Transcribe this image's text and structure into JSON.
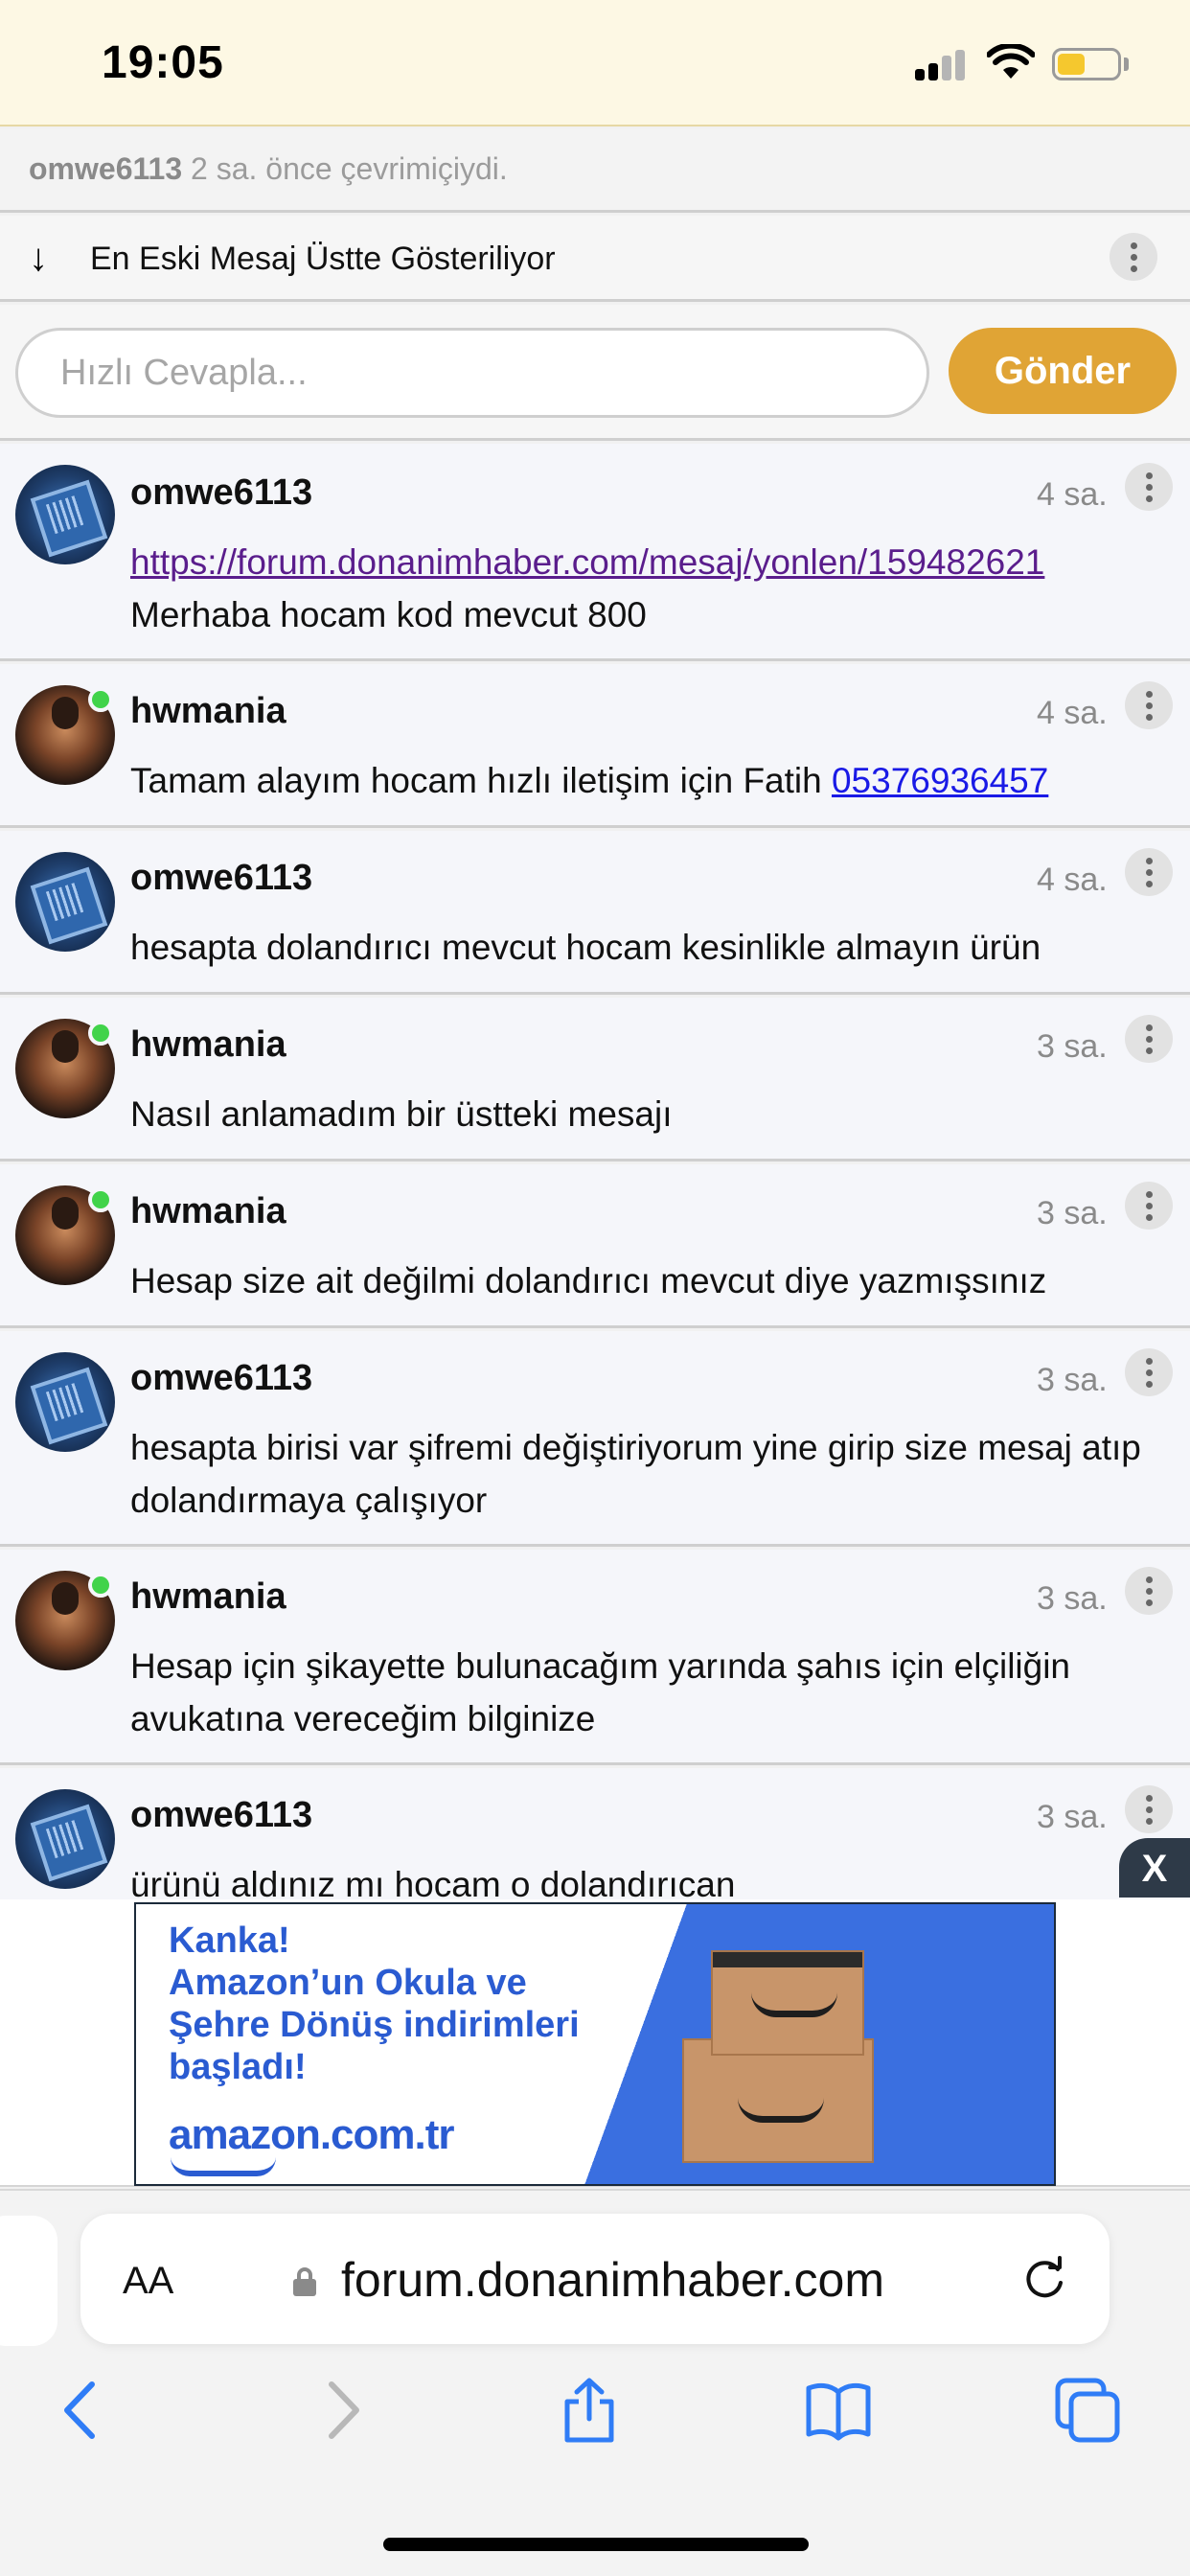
{
  "status_bar": {
    "time": "19:05"
  },
  "online_status": {
    "username": "omwe6113",
    "text": "2 sa. önce çevrimiçiydi."
  },
  "sort": {
    "label": "En Eski Mesaj Üstte Gösteriliyor"
  },
  "reply": {
    "placeholder": "Hızlı Cevapla...",
    "send_label": "Gönder"
  },
  "messages": [
    {
      "user": "omwe6113",
      "time": "4 sa.",
      "link": "https://forum.donanimhaber.com/mesaj/yonlen/159482621",
      "text": "Merhaba hocam kod mevcut 800"
    },
    {
      "user": "hwmania",
      "time": "4 sa.",
      "text": "Tamam alayım hocam hızlı iletişim için Fatih",
      "phone": "05376936457"
    },
    {
      "user": "omwe6113",
      "time": "4 sa.",
      "text": "hesapta dolandırıcı mevcut hocam kesinlikle almayın ürün"
    },
    {
      "user": "hwmania",
      "time": "3 sa.",
      "text": "Nasıl anlamadım bir üstteki mesajı"
    },
    {
      "user": "hwmania",
      "time": "3 sa.",
      "text": "Hesap size ait değilmi dolandırıcı mevcut diye yazmışsınız"
    },
    {
      "user": "omwe6113",
      "time": "3 sa.",
      "text": "hesapta birisi var şifremi değiştiriyorum yine girip size mesaj atıp dolandırmaya çalışıyor"
    },
    {
      "user": "hwmania",
      "time": "3 sa.",
      "text": "Hesap için şikayette bulunacağım yarında şahıs için elçiliğin avukatına vereceğim bilginize"
    },
    {
      "user": "omwe6113",
      "time": "3 sa.",
      "text": "ürünü aldınız mı hocam o dolandırıcan"
    }
  ],
  "ad": {
    "close_label": "X",
    "headline_1": "Kanka!",
    "headline_2": "Amazon’un Okula ve",
    "headline_3": "Şehre Dönüş indirimleri",
    "headline_4": "başladı!",
    "logo_text": "amazon.com.tr"
  },
  "browser": {
    "text_size_label": "AA",
    "url": "forum.donanimhaber.com"
  },
  "icons": {
    "status": [
      "signal-icon",
      "wifi-icon",
      "battery-icon"
    ],
    "toolbar": [
      "back-icon",
      "forward-icon",
      "share-icon",
      "bookmarks-icon",
      "tabs-icon"
    ]
  },
  "colors": {
    "accent": "#e0a435",
    "online": "#41d34a",
    "link_visited": "#5a1d8c",
    "link": "#1a1ae6",
    "ad_blue": "#3a6fe0"
  }
}
